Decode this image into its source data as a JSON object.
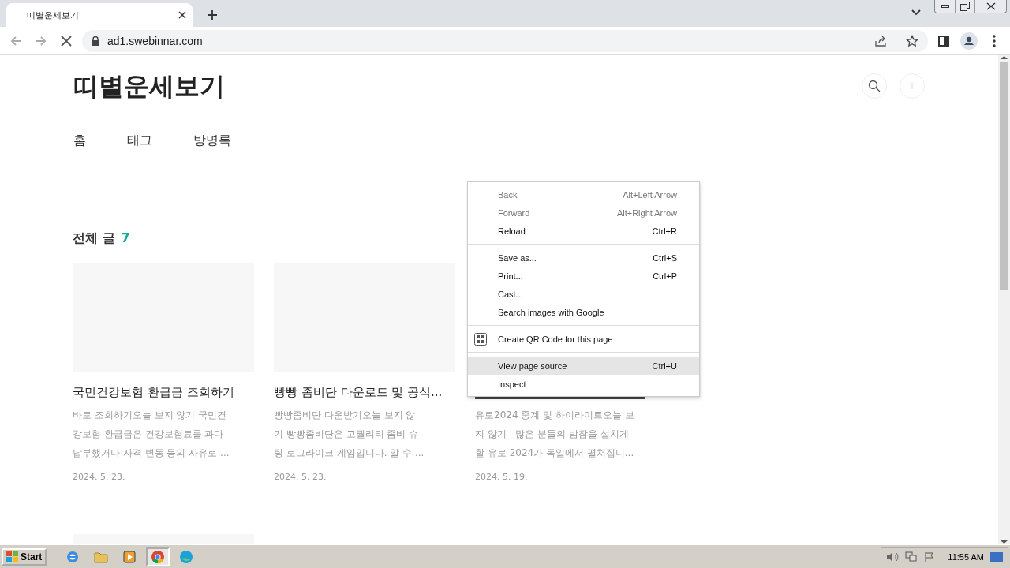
{
  "browser": {
    "tab": {
      "title": "띠별운세보기"
    },
    "address": "ad1.swebinnar.com"
  },
  "site": {
    "title": "띠별운세보기",
    "nav": [
      {
        "label": "홈"
      },
      {
        "label": "태그"
      },
      {
        "label": "방명록"
      }
    ]
  },
  "section": {
    "label": "전체 글",
    "count": "7"
  },
  "posts": [
    {
      "kind": "full",
      "title": "국민건강보험 환급금 조회하기",
      "excerpt": [
        "바로 조회하기오늘 보지 않기 국민건",
        "강보험 환급금은 건강보험료를 과다",
        "납부했거나 자격 변동 등의 사유로 ..."
      ],
      "date": "2024. 5. 23."
    },
    {
      "kind": "full",
      "title": "빵빵 좀비단 다운로드 및 공식...",
      "excerpt": [
        "빵빵좀비단 다운받기오늘 보지 않",
        "기 빵빵좀비단은 고퀄리티 좀비 슈",
        "팅 로그라이크 게임입니다. 알 수 ..."
      ],
      "date": "2024. 5. 23."
    },
    {
      "kind": "covered",
      "excerpt": [
        "유로2024 중계 및 하이라이트오늘 보",
        "지 않기   많은 분들의 밤잠을 설치게",
        "할 유로 2024가 독일에서 펼쳐집니..."
      ],
      "date": "2024. 5. 19."
    },
    {
      "kind": "partial"
    }
  ],
  "context_menu": {
    "groups": [
      [
        {
          "label": "Back",
          "shortcut": "Alt+Left Arrow",
          "disabled": true,
          "selected": false
        },
        {
          "label": "Forward",
          "shortcut": "Alt+Right Arrow",
          "disabled": true,
          "selected": false
        },
        {
          "label": "Reload",
          "shortcut": "Ctrl+R",
          "disabled": false,
          "selected": false
        }
      ],
      [
        {
          "label": "Save as...",
          "shortcut": "Ctrl+S",
          "disabled": false,
          "selected": false
        },
        {
          "label": "Print...",
          "shortcut": "Ctrl+P",
          "disabled": false,
          "selected": false
        },
        {
          "label": "Cast...",
          "disabled": false,
          "selected": false
        },
        {
          "label": "Search images with Google",
          "disabled": false,
          "selected": false
        }
      ],
      [
        {
          "label": "Create QR Code for this page",
          "kind": "qr",
          "disabled": false,
          "selected": false
        }
      ],
      [
        {
          "label": "View page source",
          "shortcut": "Ctrl+U",
          "disabled": false,
          "selected": true
        },
        {
          "label": "Inspect",
          "disabled": false,
          "selected": false
        }
      ]
    ]
  },
  "taskbar": {
    "start": "Start",
    "apps": [
      {
        "kind": "ie",
        "selected": false
      },
      {
        "kind": "folder",
        "selected": false
      },
      {
        "kind": "media",
        "selected": false
      },
      {
        "kind": "chrome",
        "selected": true
      },
      {
        "kind": "edge",
        "selected": false
      }
    ],
    "clock": "11:55 AM"
  }
}
